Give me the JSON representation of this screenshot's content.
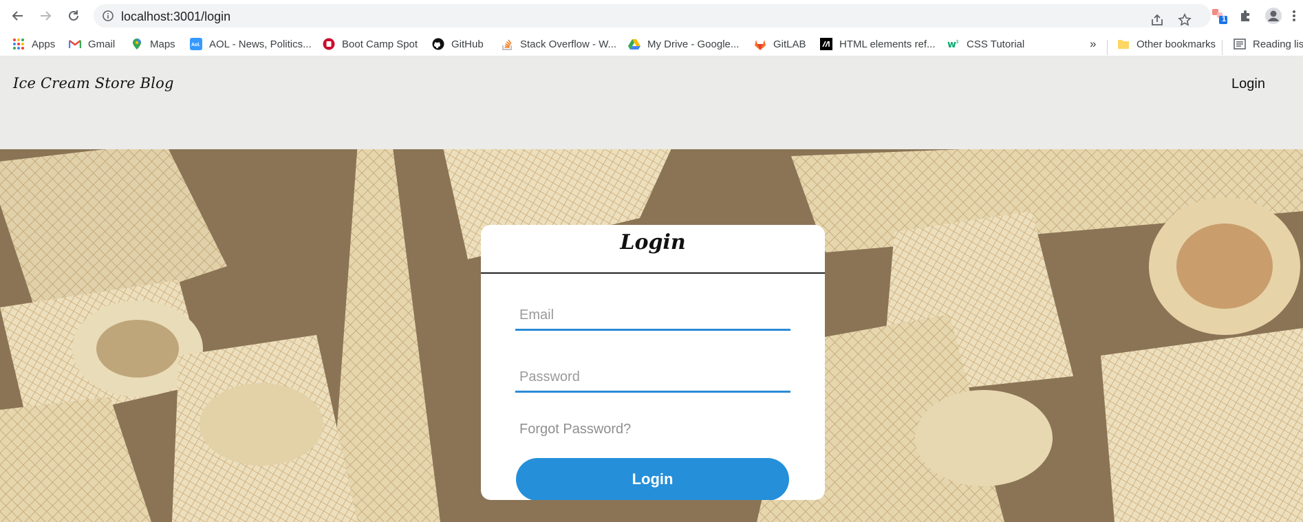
{
  "browser": {
    "url": "localhost:3001/login",
    "bookmarks": [
      {
        "label": "Apps",
        "icon": "apps-grid-icon"
      },
      {
        "label": "Gmail",
        "icon": "gmail-icon"
      },
      {
        "label": "Maps",
        "icon": "maps-pin-icon"
      },
      {
        "label": "AOL - News, Politics...",
        "icon": "aol-icon"
      },
      {
        "label": "Boot Camp Spot",
        "icon": "bootcamp-icon"
      },
      {
        "label": "GitHub",
        "icon": "github-icon"
      },
      {
        "label": "Stack Overflow - W...",
        "icon": "stackoverflow-icon"
      },
      {
        "label": "My Drive - Google...",
        "icon": "google-drive-icon"
      },
      {
        "label": "GitLAB",
        "icon": "gitlab-icon"
      },
      {
        "label": "HTML elements ref...",
        "icon": "mdn-icon"
      },
      {
        "label": "CSS Tutorial",
        "icon": "w3schools-icon"
      }
    ],
    "overflow_label": "»",
    "other_bookmarks": "Other bookmarks",
    "reading_list": "Reading lis",
    "extension_badge": "1"
  },
  "header": {
    "brand": "Ice Cream Store Blog",
    "nav_login": "Login"
  },
  "login_card": {
    "title": "Login",
    "email_placeholder": "Email",
    "password_placeholder": "Password",
    "forgot_password": "Forgot Password?",
    "submit_label": "Login"
  },
  "colors": {
    "accent": "#258fd9",
    "header_bg": "#ebebe9"
  }
}
